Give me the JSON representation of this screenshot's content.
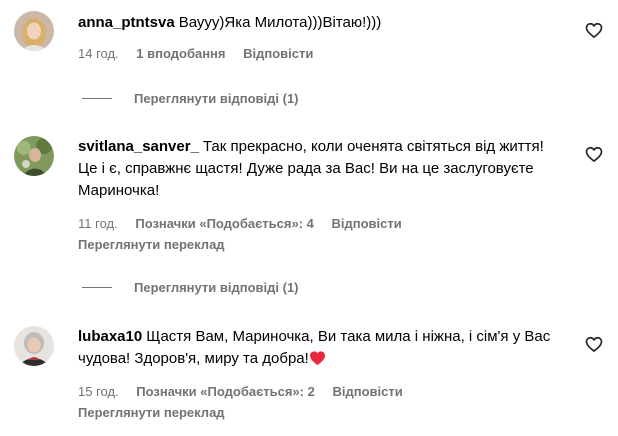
{
  "comments": [
    {
      "username": "anna_ptntsva",
      "text": "Вауyy)Яка Милота)))Вітаю!)))",
      "time": "14 год.",
      "likes": "1 вподобання",
      "reply": "Відповісти",
      "view_replies": "Переглянути відповіді (1)"
    },
    {
      "username": "svitlana_sanver_",
      "text": "Так прекрасно, коли оченята світяться від життя! Це і є, справжнє щастя! Дуже рада за Вас! Ви на це заслуговуєте Мариночка!",
      "time": "11 год.",
      "likes": "Позначки «Подобається»: 4",
      "reply": "Відповісти",
      "translate": "Переглянути переклад",
      "view_replies": "Переглянути відповіді (1)"
    },
    {
      "username": "lubaxa10",
      "text": "Щастя Вам, Мариночка, Ви така мила і ніжна, і сім'я у Вас чудова! Здоров'я, миру та добра!",
      "time": "15 год.",
      "likes": "Позначки «Подобається»: 2",
      "reply": "Відповісти",
      "translate": "Переглянути переклад"
    }
  ],
  "colors": {
    "secondary_text": "#737373",
    "primary_text": "#000000",
    "heart_red": "#e8283c"
  },
  "icons": {
    "like": "heart-outline-icon",
    "emoji": "red-heart-emoji"
  }
}
